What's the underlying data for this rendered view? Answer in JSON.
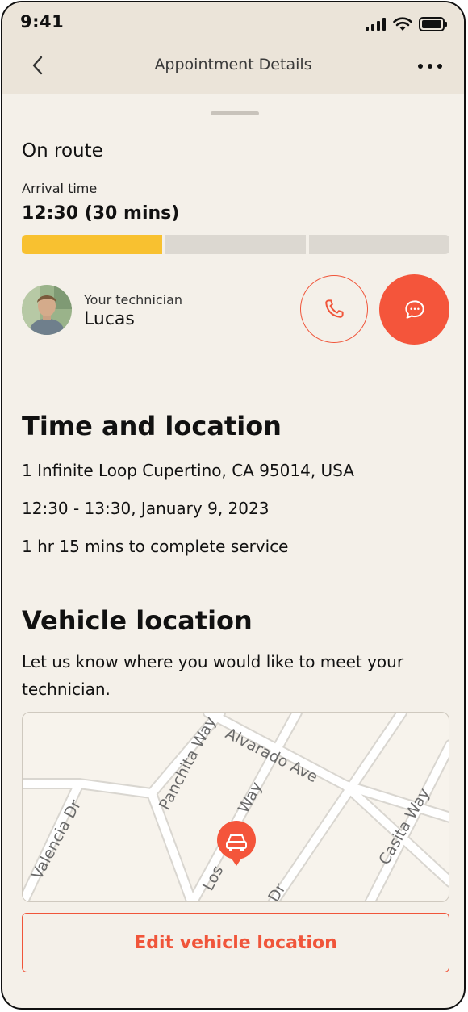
{
  "status_bar": {
    "time": "9:41"
  },
  "nav": {
    "title": "Appointment Details"
  },
  "appointment": {
    "status": "On route",
    "arrival_label": "Arrival time",
    "arrival_value": "12:30 (30 mins)",
    "progress_segments_filled": 1,
    "progress_segments_total": 3
  },
  "technician": {
    "label": "Your technician",
    "name": "Lucas"
  },
  "time_location": {
    "heading": "Time and location",
    "address": "1 Infinite Loop Cupertino, CA 95014, USA",
    "time_range": "12:30 - 13:30, January 9, 2023",
    "duration": "1 hr 15 mins to complete service"
  },
  "vehicle": {
    "heading": "Vehicle location",
    "description": "Let us know where you would like to meet your technician.",
    "edit_label": "Edit vehicle location"
  },
  "map": {
    "streets": [
      "Alvarado Ave",
      "Panchita Way",
      "Valencia Dr",
      "Los",
      "Way",
      "Casita Way",
      "Dr"
    ]
  },
  "colors": {
    "accent": "#f4553b",
    "progress": "#f8c130",
    "background": "#f4f0e9",
    "header": "#ebe4d9"
  },
  "icons": [
    "back-chevron-icon",
    "more-icon",
    "phone-icon",
    "chat-bubble-icon",
    "car-pin-icon",
    "signal-icon",
    "wifi-icon",
    "battery-icon"
  ]
}
